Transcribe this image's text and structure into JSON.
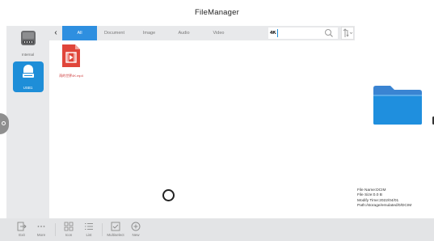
{
  "window": {
    "title": "FileManager"
  },
  "sidebar": {
    "devices": [
      {
        "label": "Internal",
        "icon": "hard-drive-icon",
        "selected": false
      },
      {
        "label": "USB1",
        "icon": "usb-drive-icon",
        "selected": true
      }
    ]
  },
  "tabs": [
    {
      "label": "All",
      "active": true
    },
    {
      "label": "Document",
      "active": false
    },
    {
      "label": "Image",
      "active": false
    },
    {
      "label": "Audio",
      "active": false
    },
    {
      "label": "Video",
      "active": false
    }
  ],
  "search": {
    "value": "4K",
    "icon": "search-icon"
  },
  "files": [
    {
      "name": "雨的世界4K.mp4",
      "icon": "video-file-icon"
    }
  ],
  "info": {
    "icon": "folder-icon",
    "file_name": "File Name:DCIM",
    "file_size": "File Size:0.0 B",
    "modify_time": "Modify Time:2022/04/01",
    "path": "Path:/storage/emulated/0/DCIM"
  },
  "toolbar": {
    "exit": "Exit",
    "more": "More",
    "icon": "Icon",
    "list": "List",
    "multiselect": "Multiselect",
    "new": "New"
  },
  "colors": {
    "accent": "#2e8fe0",
    "sidebar_bg": "#e8e9eb",
    "toolbar_bg": "#e3e4e6",
    "file_red": "#e0453a"
  }
}
